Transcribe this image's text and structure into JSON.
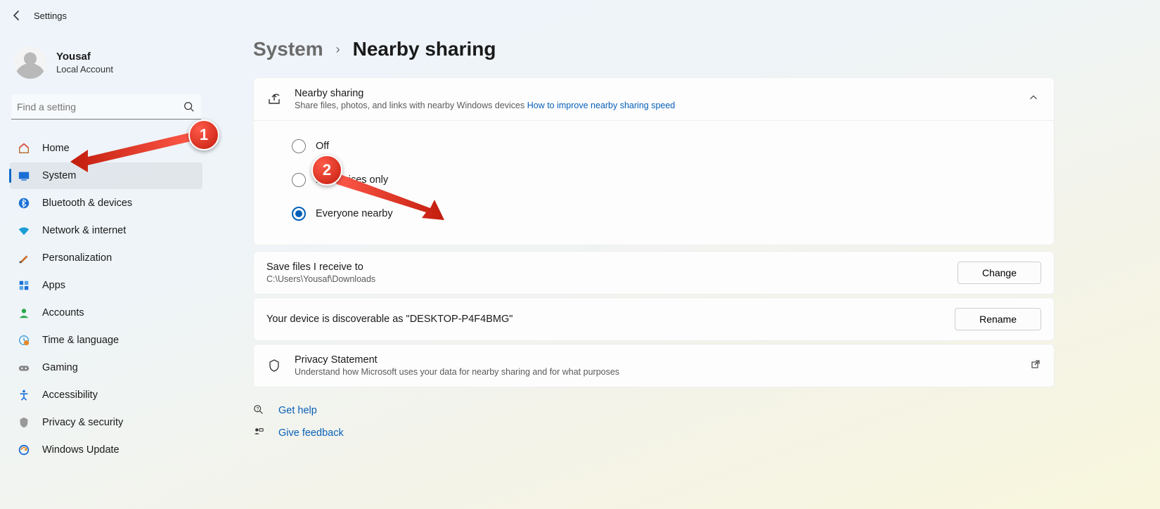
{
  "titlebar": {
    "app_title": "Settings"
  },
  "profile": {
    "name": "Yousaf",
    "subtitle": "Local Account"
  },
  "search": {
    "placeholder": "Find a setting"
  },
  "nav": {
    "items": [
      {
        "label": "Home"
      },
      {
        "label": "System"
      },
      {
        "label": "Bluetooth & devices"
      },
      {
        "label": "Network & internet"
      },
      {
        "label": "Personalization"
      },
      {
        "label": "Apps"
      },
      {
        "label": "Accounts"
      },
      {
        "label": "Time & language"
      },
      {
        "label": "Gaming"
      },
      {
        "label": "Accessibility"
      },
      {
        "label": "Privacy & security"
      },
      {
        "label": "Windows Update"
      }
    ]
  },
  "breadcrumb": {
    "parent": "System",
    "page": "Nearby sharing"
  },
  "sharing_card": {
    "title": "Nearby sharing",
    "subtitle": "Share files, photos, and links with nearby Windows devices",
    "help_link": "How to improve nearby sharing speed",
    "options": {
      "off": "Off",
      "my_devices": "My devices only",
      "everyone": "Everyone nearby"
    }
  },
  "save_row": {
    "title": "Save files I receive to",
    "path": "C:\\Users\\Yousaf\\Downloads",
    "button": "Change"
  },
  "discover_row": {
    "title": "Your device is discoverable as \"DESKTOP-P4F4BMG\"",
    "button": "Rename"
  },
  "privacy_row": {
    "title": "Privacy Statement",
    "subtitle": "Understand how Microsoft uses your data for nearby sharing and for what purposes"
  },
  "links": {
    "help": "Get help",
    "feedback": "Give feedback"
  },
  "annotations": {
    "badge1": "1",
    "badge2": "2"
  }
}
